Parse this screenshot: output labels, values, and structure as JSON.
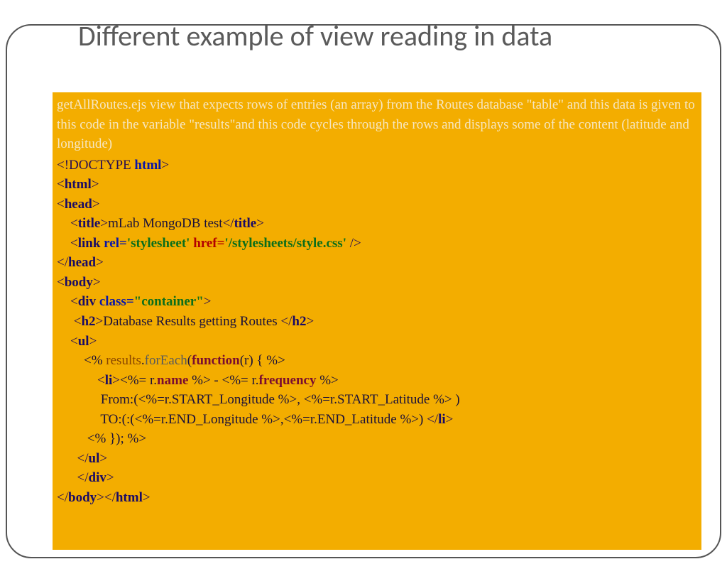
{
  "slide": {
    "title": "Different example of view reading in data",
    "description": "getAllRoutes.ejs view that expects rows of entries (an array) from the Routes database \"table\" and this data is given to this code in the variable \"results\"and this code cycles through the rows and displays some of the content (latitude and longitude)"
  },
  "code": {
    "l1_a": "<!DOCTYPE ",
    "l1_b": "html",
    "l1_c": ">",
    "l2_a": "<",
    "l2_b": "html",
    "l2_c": ">",
    "l3_a": "<",
    "l3_b": "head",
    "l3_c": ">",
    "l4_a": "    <",
    "l4_b": "title",
    "l4_c": ">",
    "l4_d": "mLab MongoDB test",
    "l4_e": "</",
    "l4_f": "title",
    "l4_g": ">",
    "l5_a": "    <",
    "l5_b": "link ",
    "l5_c": "rel=",
    "l5_d": "'stylesheet'",
    "l5_e": " href=",
    "l5_f": "'/stylesheets/style.css'",
    "l5_g": " />",
    "l6_a": "</",
    "l6_b": "head",
    "l6_c": ">",
    "l7_a": "<",
    "l7_b": "body",
    "l7_c": ">",
    "l8_a": "    <",
    "l8_b": "div ",
    "l8_c": "class=",
    "l8_d": "\"container\"",
    "l8_e": ">",
    "l9_a": "     <",
    "l9_b": "h2",
    "l9_c": ">",
    "l9_d": "Database Results getting Routes ",
    "l9_e": "</",
    "l9_f": "h2",
    "l9_g": ">",
    "l10_a": "    <",
    "l10_b": "ul",
    "l10_c": ">",
    "l11_a": "        <% ",
    "l11_b": "results",
    "l11_c": ".",
    "l11_d": "forEach",
    "l11_e": "(",
    "l11_f": "function",
    "l11_g": "(r) { %>",
    "l12_a": "            <",
    "l12_b": "li",
    "l12_c": ">",
    "l12_d": "<%= r.",
    "l12_e": "name",
    "l12_f": " %> - <%= r.",
    "l12_g": "frequency",
    "l12_h": " %>",
    "l13": "             From:(<%=r.START_Longitude %>, <%=r.START_Latitude %> )",
    "l14_a": "             TO:(:(<%=r.END_Longitude %>,<%=r.END_Latitude %>) ",
    "l14_b": "</",
    "l14_c": "li",
    "l14_d": ">",
    "l15": "         <% }); %>",
    "l16_a": "      </",
    "l16_b": "ul",
    "l16_c": ">",
    "l17_a": "      </",
    "l17_b": "div",
    "l17_c": ">",
    "l18": "",
    "l19_a": "</",
    "l19_b": "body",
    "l19_c": "></",
    "l19_d": "html",
    "l19_e": ">"
  }
}
